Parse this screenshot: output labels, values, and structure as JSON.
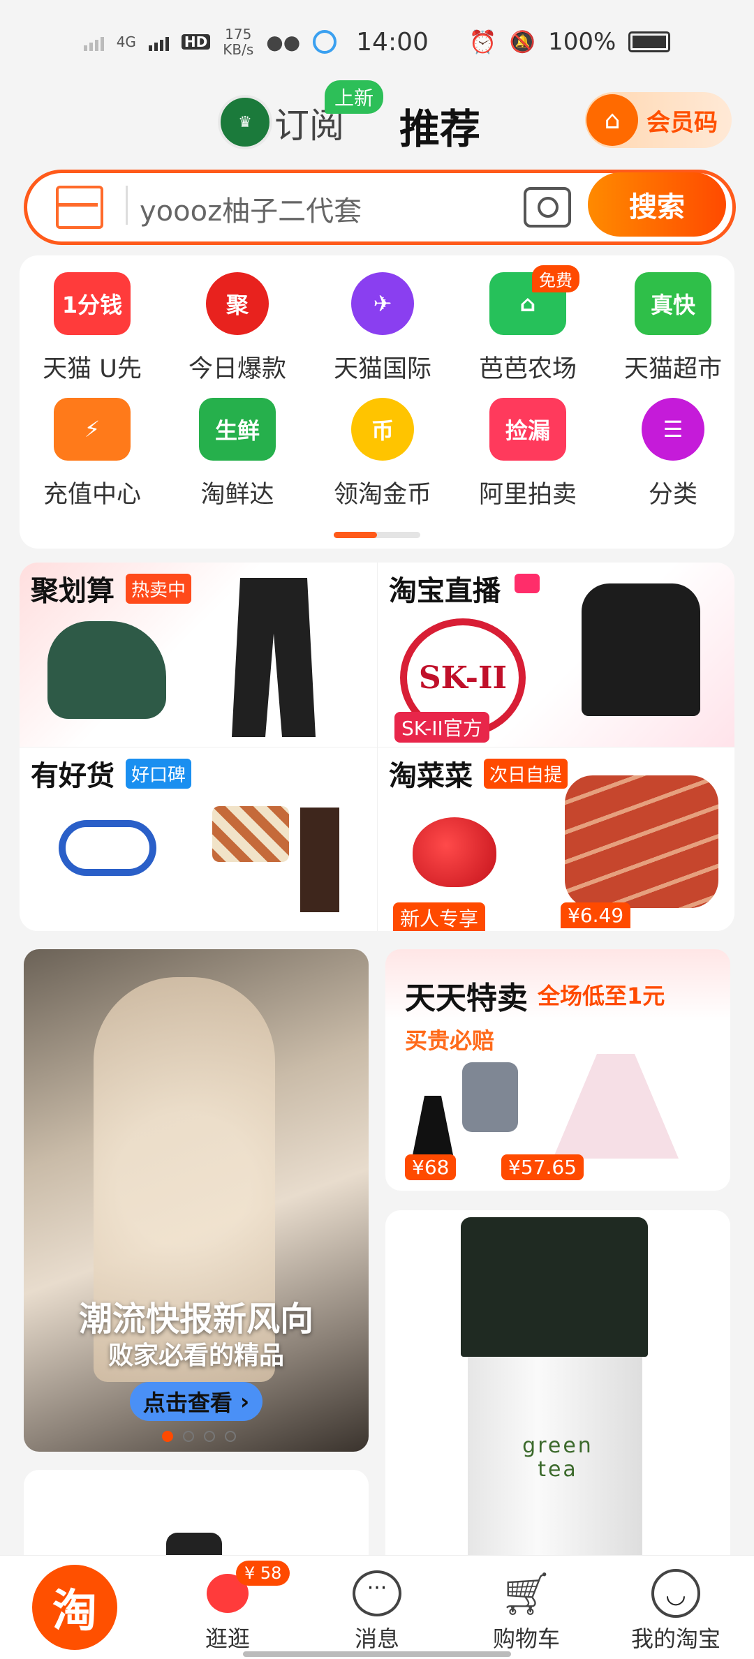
{
  "status_bar": {
    "network": "4G",
    "hd": "HD",
    "speed_value": "175",
    "speed_unit": "KB/s",
    "time": "14:00",
    "battery": "100%"
  },
  "header": {
    "subscribe_label": "订阅",
    "new_badge": "上新",
    "recommend_label": "推荐",
    "member_code_label": "会员码"
  },
  "search": {
    "placeholder": "yoooz柚子二代套",
    "button_label": "搜索"
  },
  "quick_icons": [
    {
      "label": "天猫 U先",
      "icon_text": "1分钱",
      "badge": "",
      "color": "#ff3b3b"
    },
    {
      "label": "今日爆款",
      "icon_text": "聚",
      "badge": "",
      "color": "#e8221e"
    },
    {
      "label": "天猫国际",
      "icon_text": "✈",
      "badge": "",
      "color": "#8a3ff0"
    },
    {
      "label": "芭芭农场",
      "icon_text": "⌂",
      "badge": "免费",
      "color": "#26c15a"
    },
    {
      "label": "天猫超市",
      "icon_text": "真快",
      "badge": "",
      "color": "#2fbf49"
    },
    {
      "label": "充值中心",
      "icon_text": "⚡",
      "badge": "",
      "color": "#ff7a1a"
    },
    {
      "label": "淘鲜达",
      "icon_text": "生鲜",
      "badge": "",
      "color": "#26b04c"
    },
    {
      "label": "领淘金币",
      "icon_text": "币",
      "badge": "",
      "color": "#ffc400"
    },
    {
      "label": "阿里拍卖",
      "icon_text": "捡漏",
      "badge": "",
      "color": "#ff3a5c"
    },
    {
      "label": "分类",
      "icon_text": "☰",
      "badge": "",
      "color": "#c51bd9"
    }
  ],
  "promo": {
    "juhuasuan": {
      "title": "聚划算",
      "tag": "热卖中"
    },
    "live": {
      "title": "淘宝直播",
      "tag": "SK-II官方",
      "brand": "SK-II"
    },
    "haohuo": {
      "title": "有好货",
      "tag": "好口碑"
    },
    "taocaicai": {
      "title": "淘菜菜",
      "tag": "次日自提",
      "tag1": "新人专享",
      "price": "¥6.49"
    }
  },
  "feed": {
    "banner_title": "潮流快报新风向",
    "banner_subtitle": "败家必看的精品",
    "banner_button": "点击查看",
    "banner_chevron": "›",
    "daily_title": "天天特卖",
    "daily_subtitle": "全场低至1元",
    "daily_tag": "买贵必赔",
    "price1": "¥68",
    "price2": "¥57.65",
    "bottle_text1": "green",
    "bottle_text2": "tea"
  },
  "tabbar": {
    "home_icon": "淘",
    "browse": "逛逛",
    "browse_badge": "¥ 58",
    "messages": "消息",
    "cart": "购物车",
    "my": "我的淘宝"
  }
}
